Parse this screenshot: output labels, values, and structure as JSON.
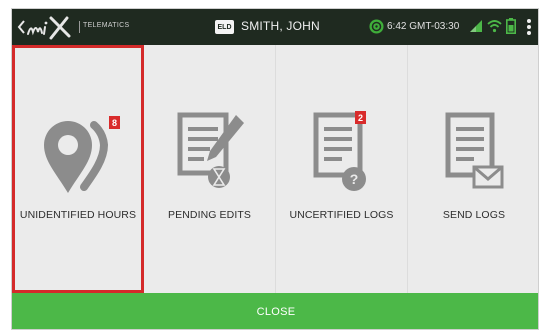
{
  "header": {
    "brand_sub": "TELEMATICS",
    "eld_badge": "ELD",
    "driver_name": "SMITH, JOHN",
    "clock": "6:42 GMT-03:30"
  },
  "tiles": [
    {
      "label": "UNIDENTIFIED HOURS",
      "badge": "8",
      "icon": "location-pin-icon",
      "selected": true
    },
    {
      "label": "PENDING EDITS",
      "badge": "",
      "icon": "edit-document-icon",
      "selected": false
    },
    {
      "label": "UNCERTIFIED LOGS",
      "badge": "2",
      "icon": "uncertified-document-icon",
      "selected": false
    },
    {
      "label": "SEND LOGS",
      "badge": "",
      "icon": "send-document-icon",
      "selected": false
    }
  ],
  "footer": {
    "close_label": "CLOSE"
  },
  "colors": {
    "topbar": "#1f2a20",
    "accent_green": "#4cb848",
    "selection_red": "#d42a2a",
    "badge_red": "#d92b2b",
    "icon_gray": "#8c8c8c"
  }
}
